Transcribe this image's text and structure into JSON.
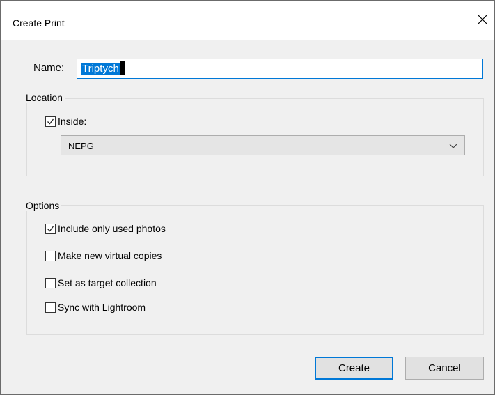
{
  "dialog": {
    "title": "Create Print"
  },
  "name_field": {
    "label": "Name:",
    "value": "Triptych"
  },
  "location": {
    "legend": "Location",
    "inside_checkbox": {
      "label": "Inside:",
      "checked": true
    },
    "select": {
      "value": "NEPG"
    }
  },
  "options": {
    "legend": "Options",
    "items": [
      {
        "label": "Include only used photos",
        "checked": true
      },
      {
        "label": "Make new virtual copies",
        "checked": false
      },
      {
        "label": "Set as target collection",
        "checked": false
      },
      {
        "label": "Sync with Lightroom",
        "checked": false
      }
    ]
  },
  "buttons": {
    "create": "Create",
    "cancel": "Cancel"
  },
  "colors": {
    "accent": "#0078d7",
    "dialog_bg": "#f0f0f0"
  },
  "icons": {
    "close": "close-icon",
    "check": "check-icon",
    "chevron": "chevron-down-icon"
  }
}
